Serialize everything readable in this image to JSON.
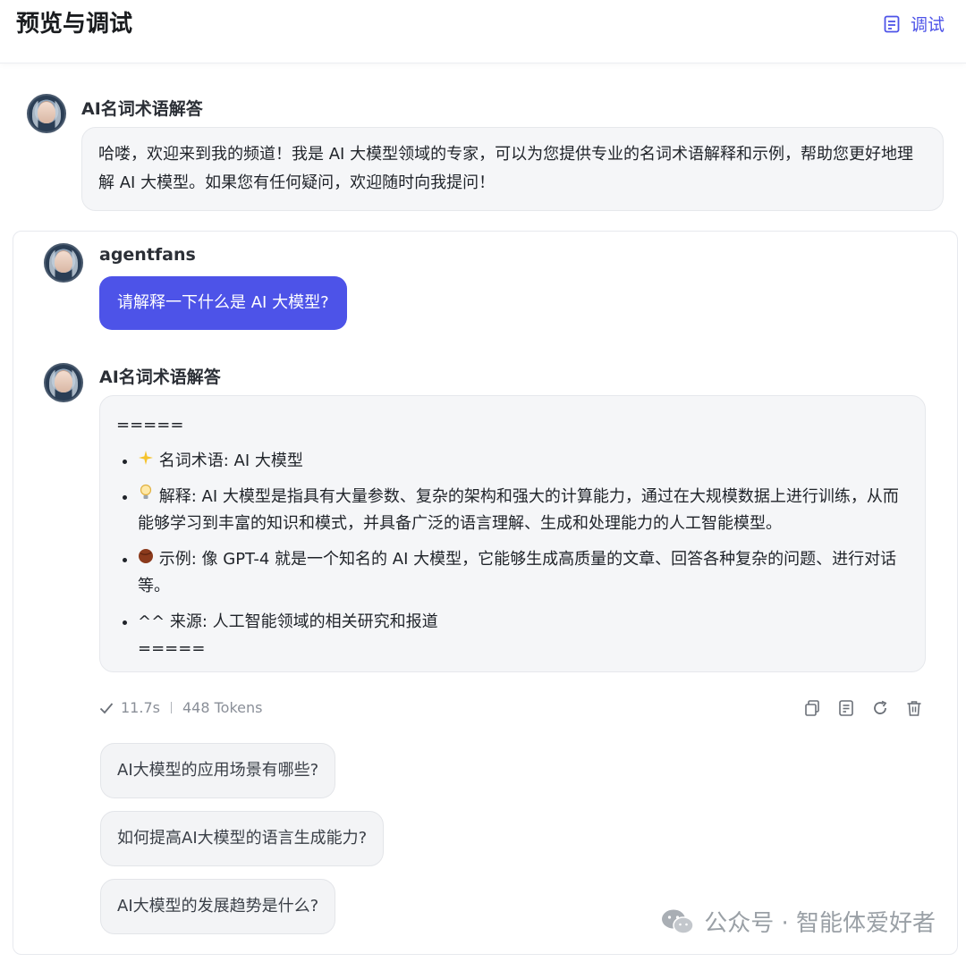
{
  "header": {
    "title": "预览与调试",
    "debug_label": "调试"
  },
  "intro": {
    "bot_name": "AI名词术语解答",
    "greeting": "哈喽，欢迎来到我的频道！我是 AI 大模型领域的专家，可以为您提供专业的名词术语解释和示例，帮助您更好地理解 AI 大模型。如果您有任何疑问，欢迎随时向我提问！"
  },
  "conversation": {
    "user_name": "agentfans",
    "user_message": "请解释一下什么是 AI 大模型?",
    "bot_name": "AI名词术语解答",
    "answer": {
      "top_rule": "=====",
      "items": [
        {
          "icon": "sparkle-icon",
          "text": "名词术语: AI 大模型"
        },
        {
          "icon": "lightbulb-icon",
          "text": "解释: AI 大模型是指具有大量参数、复杂的架构和强大的计算能力，通过在大规模数据上进行训练，从而能够学习到丰富的知识和模式，并具备广泛的语言理解、生成和处理能力的人工智能模型。"
        },
        {
          "icon": "ball-icon",
          "text": "示例: 像 GPT-4 就是一个知名的 AI 大模型，它能够生成高质量的文章、回答各种复杂的问题、进行对话等。"
        },
        {
          "icon": "none",
          "text": "^^ 来源: 人工智能领域的相关研究和报道"
        }
      ],
      "bottom_rule": "====="
    },
    "meta": {
      "time": "11.7s",
      "tokens": "448 Tokens"
    }
  },
  "suggestions": [
    "AI大模型的应用场景有哪些?",
    "如何提高AI大模型的语言生成能力?",
    "AI大模型的发展趋势是什么?"
  ],
  "watermark": "公众号 · 智能体爱好者",
  "colors": {
    "accent": "#4d53e8",
    "bubble_bg": "#f5f6f8"
  }
}
